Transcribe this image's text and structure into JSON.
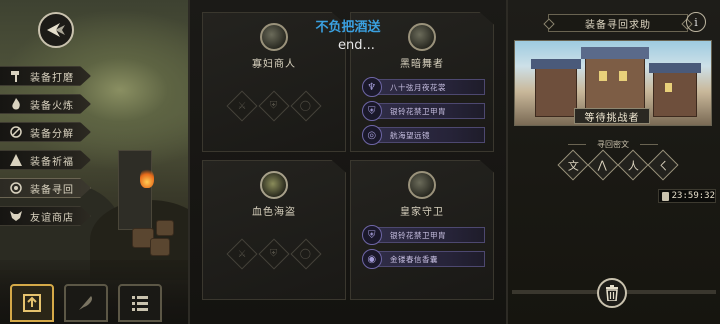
{
  "nav": {
    "items": [
      {
        "label": "装备打磨",
        "icon": "hammer-icon",
        "glyph": "🔨",
        "active": false
      },
      {
        "label": "装备火炼",
        "icon": "flame-icon",
        "glyph": "🔥",
        "active": false
      },
      {
        "label": "装备分解",
        "icon": "dismantle-icon",
        "glyph": "⚒",
        "active": false
      },
      {
        "label": "装备祈福",
        "icon": "blessing-icon",
        "glyph": "⛩",
        "active": false
      },
      {
        "label": "装备寻回",
        "icon": "retrieve-icon",
        "glyph": "◎",
        "active": true
      },
      {
        "label": "友谊商店",
        "icon": "fox-icon",
        "glyph": "🦊",
        "active": false
      }
    ]
  },
  "overlay": {
    "title": "不负把酒送",
    "subtitle": "end..."
  },
  "cards": {
    "widow_merchant": {
      "name": "寡妇商人",
      "portrait": "widow-merchant-portrait"
    },
    "dark_dancer": {
      "name": "黑暗舞者",
      "portrait": "dark-dancer-portrait",
      "rewards": [
        "八十弦月夜花裳",
        "银铃花禁卫甲胄",
        "航海望远镜"
      ]
    },
    "blood_pirate": {
      "name": "血色海盗",
      "portrait": "blood-pirate-portrait"
    },
    "royal_guard": {
      "name": "皇家守卫",
      "portrait": "royal-guard-portrait",
      "rewards": [
        "银铃花禁卫甲胄",
        "金镂春信香囊"
      ]
    }
  },
  "right_panel": {
    "header": "装备寻回求助",
    "info": "i",
    "status": "等待挑战者",
    "secret_label": "寻回密文",
    "runes": [
      "文",
      "⋀",
      "人",
      "ㄑ"
    ],
    "timer": "23:59:32"
  },
  "colors": {
    "accent_gold": "#d5a948",
    "reward_purple": "#4d4870",
    "overlay_blue": "#3aa0e0"
  }
}
